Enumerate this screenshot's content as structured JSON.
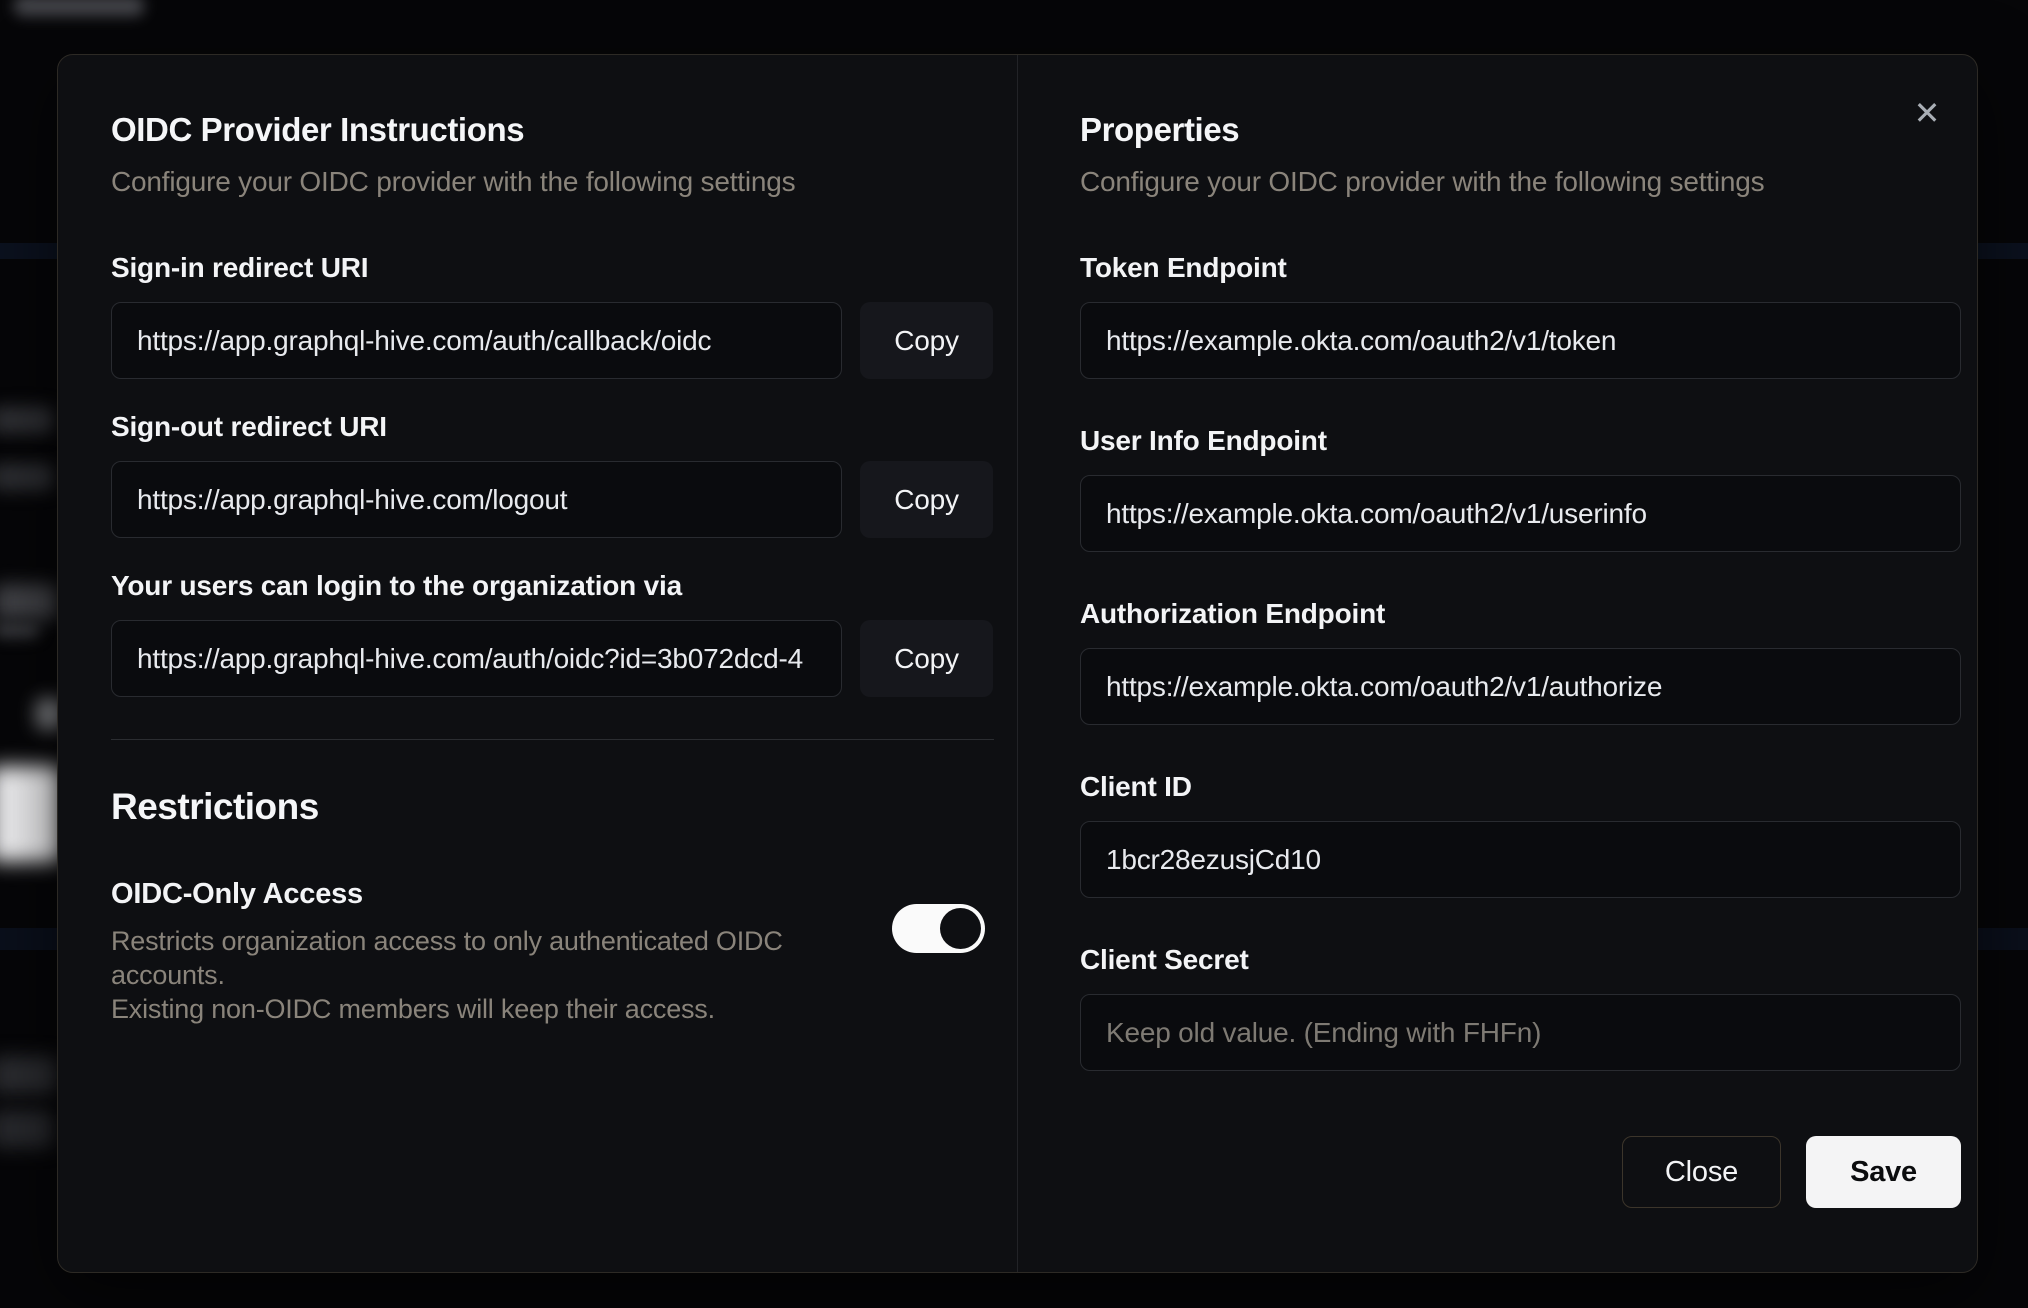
{
  "dialog": {
    "close_icon": "✕",
    "left": {
      "title": "OIDC Provider Instructions",
      "subtitle": "Configure your OIDC provider with the following settings",
      "copy_label": "Copy",
      "fields": [
        {
          "label": "Sign-in redirect URI",
          "value": "https://app.graphql-hive.com/auth/callback/oidc"
        },
        {
          "label": "Sign-out redirect URI",
          "value": "https://app.graphql-hive.com/logout"
        },
        {
          "label": "Your users can login to the organization via",
          "value": "https://app.graphql-hive.com/auth/oidc?id=3b072dcd-4"
        }
      ],
      "restrictions": {
        "title": "Restrictions",
        "toggle_label": "OIDC-Only Access",
        "description_line1": "Restricts organization access to only authenticated OIDC accounts.",
        "description_line2": "Existing non-OIDC members will keep their access.",
        "toggle_state": "on"
      }
    },
    "right": {
      "title": "Properties",
      "subtitle": "Configure your OIDC provider with the following settings",
      "fields": [
        {
          "label": "Token Endpoint",
          "value": "https://example.okta.com/oauth2/v1/token"
        },
        {
          "label": "User Info Endpoint",
          "value": "https://example.okta.com/oauth2/v1/userinfo"
        },
        {
          "label": "Authorization Endpoint",
          "value": "https://example.okta.com/oauth2/v1/authorize"
        },
        {
          "label": "Client ID",
          "value": "1bcr28ezusjCd10"
        },
        {
          "label": "Client Secret",
          "value": "",
          "placeholder": "Keep old value. (Ending with FHFn)"
        }
      ],
      "buttons": {
        "close": "Close",
        "save": "Save"
      }
    },
    "colors": {
      "modal_background": "#0e0f12",
      "input_background": "#0a0b0e",
      "input_border": "#292b30",
      "copy_button_background": "#16171c",
      "save_button_background": "#f4f4f5",
      "toggle_on_track": "#fafafa",
      "toggle_knob": "#0e0f12",
      "heading_text": "#f5f6f8",
      "muted_text": "#8a847b"
    }
  }
}
